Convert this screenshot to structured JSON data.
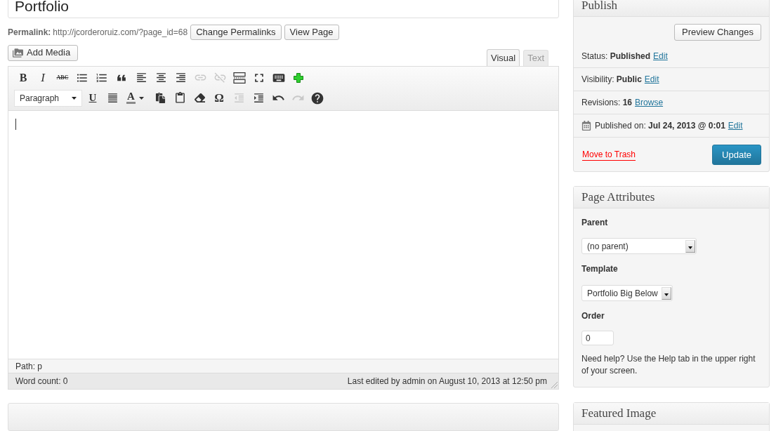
{
  "title_field": {
    "value": "Portfolio"
  },
  "permalink": {
    "label": "Permalink:",
    "url": "http://jcorderoruiz.com/?page_id=68",
    "buttons": [
      "Change Permalinks",
      "View Page"
    ]
  },
  "add_media_button": "Add Media",
  "editor_tabs": [
    {
      "label": "Visual",
      "selected": true
    },
    {
      "label": "Text",
      "selected": false
    }
  ],
  "toolbar": {
    "first_row": [
      {
        "kind": "bold",
        "glyph": "B",
        "disabled": false
      },
      {
        "kind": "italic",
        "glyph": "I",
        "disabled": false
      },
      {
        "kind": "strikethrough",
        "glyph": "ABC",
        "disabled": false
      },
      {
        "kind": "bullet-list",
        "disabled": false
      },
      {
        "kind": "numbered-list",
        "disabled": false
      },
      {
        "kind": "blockquote",
        "disabled": false
      },
      {
        "kind": "align-left",
        "disabled": false
      },
      {
        "kind": "align-center",
        "disabled": false
      },
      {
        "kind": "align-right",
        "disabled": false
      },
      {
        "kind": "link",
        "disabled": true
      },
      {
        "kind": "unlink",
        "disabled": true
      },
      {
        "kind": "more-tag",
        "disabled": false
      },
      {
        "kind": "fullscreen",
        "disabled": false
      },
      {
        "kind": "kitchen-sink",
        "disabled": false
      },
      {
        "kind": "add",
        "disabled": false
      }
    ],
    "second_row": [
      {
        "kind": "format-select",
        "value": "Paragraph",
        "disabled": false
      },
      {
        "kind": "underline",
        "glyph": "U",
        "disabled": false
      },
      {
        "kind": "justify",
        "disabled": false
      },
      {
        "kind": "text-color",
        "glyph": "A",
        "disabled": false
      },
      {
        "kind": "paste-text",
        "disabled": false
      },
      {
        "kind": "paste-word",
        "disabled": false
      },
      {
        "kind": "eraser",
        "disabled": false
      },
      {
        "kind": "special-character",
        "glyph": "Ω",
        "disabled": false
      },
      {
        "kind": "outdent",
        "disabled": true
      },
      {
        "kind": "indent",
        "disabled": false
      },
      {
        "kind": "undo",
        "disabled": false
      },
      {
        "kind": "redo",
        "disabled": true
      },
      {
        "kind": "help",
        "disabled": false
      }
    ]
  },
  "editor_status": {
    "path": "Path: p",
    "word_count": "Word count: 0",
    "last_edited": "Last edited by admin on August 10, 2013 at 12:50 pm"
  },
  "publish": {
    "title": "Publish",
    "preview_button": "Preview Changes",
    "rows": [
      {
        "kind": "plain",
        "text": "Status: **Published**",
        "link": "Edit"
      },
      {
        "kind": "plain",
        "text": "Visibility: **Public**",
        "link": "Edit"
      },
      {
        "kind": "plain",
        "text": "Revisions: **16**",
        "link": "Browse"
      },
      {
        "kind": "date",
        "text": "Published on: **Jul 24, 2013 @ 0:01**",
        "link": "Edit"
      }
    ],
    "trash_link": "Move to Trash",
    "update_button": "Update"
  },
  "page_attributes": {
    "title": "Page Attributes",
    "fields": [
      {
        "kind": "select",
        "label": "Parent",
        "value": "(no parent)"
      },
      {
        "kind": "select",
        "label": "Template",
        "value": "Portfolio Big Below"
      },
      {
        "kind": "input",
        "label": "Order",
        "value": "0"
      }
    ],
    "help": "Need help? Use the Help tab in the upper right of your screen."
  },
  "featured_image": {
    "title": "Featured Image"
  }
}
